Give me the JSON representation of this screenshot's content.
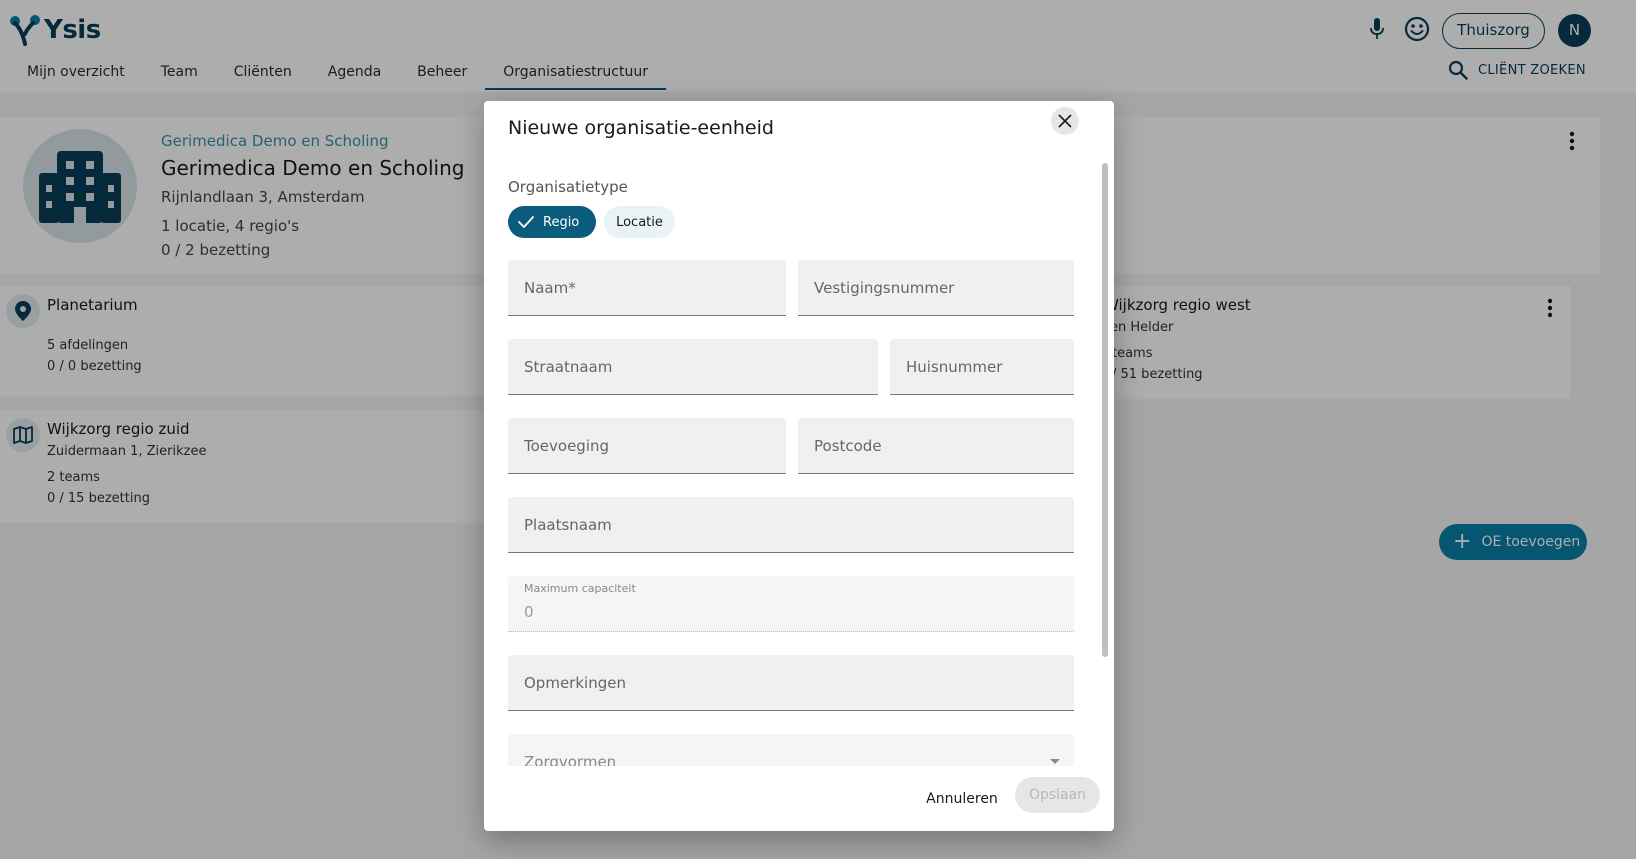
{
  "app": {
    "logo_text": "Ysis"
  },
  "nav": {
    "items": [
      "Mijn overzicht",
      "Team",
      "Cliënten",
      "Agenda",
      "Beheer",
      "Organisatiestructuur"
    ]
  },
  "header": {
    "org_button": "Thuiszorg",
    "avatar_initial": "N",
    "client_search": "CLIËNT ZOEKEN"
  },
  "hero": {
    "breadcrumb": "Gerimedica Demo en Scholing",
    "title": "Gerimedica Demo en Scholing",
    "address": "Rijnlandlaan 3, Amsterdam",
    "summary": "1 locatie, 4 regio's",
    "occupancy": "0 / 2 bezetting"
  },
  "cards": {
    "planetarium": {
      "title": "Planetarium",
      "line1": "5 afdelingen",
      "line2": "0 / 0 bezetting"
    },
    "zuid": {
      "title": "Wijkzorg regio zuid",
      "address": "Zuidermaan 1, Zierikzee",
      "line1": "2 teams",
      "line2": "0 / 15 bezetting"
    },
    "west": {
      "title": "Wijkzorg regio west",
      "address": "en Helder",
      "line1": "teams",
      "line2": "/ 51 bezetting"
    }
  },
  "fab": {
    "label": "OE toevoegen"
  },
  "dialog": {
    "title": "Nieuwe organisatie-eenheid",
    "type_label": "Organisatietype",
    "chips": {
      "regio": "Regio",
      "locatie": "Locatie"
    },
    "fields": {
      "naam": "Naam*",
      "vestigingsnummer": "Vestigingsnummer",
      "straatnaam": "Straatnaam",
      "huisnummer": "Huisnummer",
      "toevoeging": "Toevoeging",
      "postcode": "Postcode",
      "plaatsnaam": "Plaatsnaam",
      "max_capaciteit_label": "Maximum capaciteit",
      "max_capaciteit_value": "0",
      "opmerkingen": "Opmerkingen",
      "zorgvormen": "Zorgvormen"
    },
    "cancel": "Annuleren",
    "save": "Opslaan"
  },
  "colors": {
    "primary": "#0a3d57",
    "accent": "#0a7fa8",
    "chip_selected": "#0a5b7c"
  },
  "icons": [
    "mic-icon",
    "smiley-icon",
    "search-icon",
    "building-icon",
    "location-pin-icon",
    "map-icon",
    "more-vert-icon",
    "close-icon",
    "check-icon",
    "plus-icon",
    "chevron-down-icon"
  ]
}
